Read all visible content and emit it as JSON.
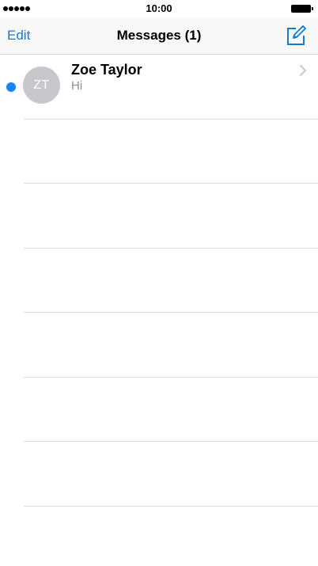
{
  "status_bar": {
    "signal_icon": "signal-dots-icon",
    "signal_bars": 5,
    "time": "10:00",
    "battery_icon": "battery-full-icon"
  },
  "nav": {
    "edit_label": "Edit",
    "title": "Messages (1)",
    "compose_icon": "compose-icon"
  },
  "conversations": [
    {
      "avatar_initials": "ZT",
      "name": "Zoe Taylor",
      "preview": "Hi",
      "unread": true
    }
  ],
  "empty_row_count": 7,
  "colors": {
    "accent": "#1479d6",
    "unread_dot": "#1a82fb",
    "avatar_bg": "#c8c7cc",
    "secondary_text": "#8e8e93",
    "separator": "#dcdcdf"
  }
}
